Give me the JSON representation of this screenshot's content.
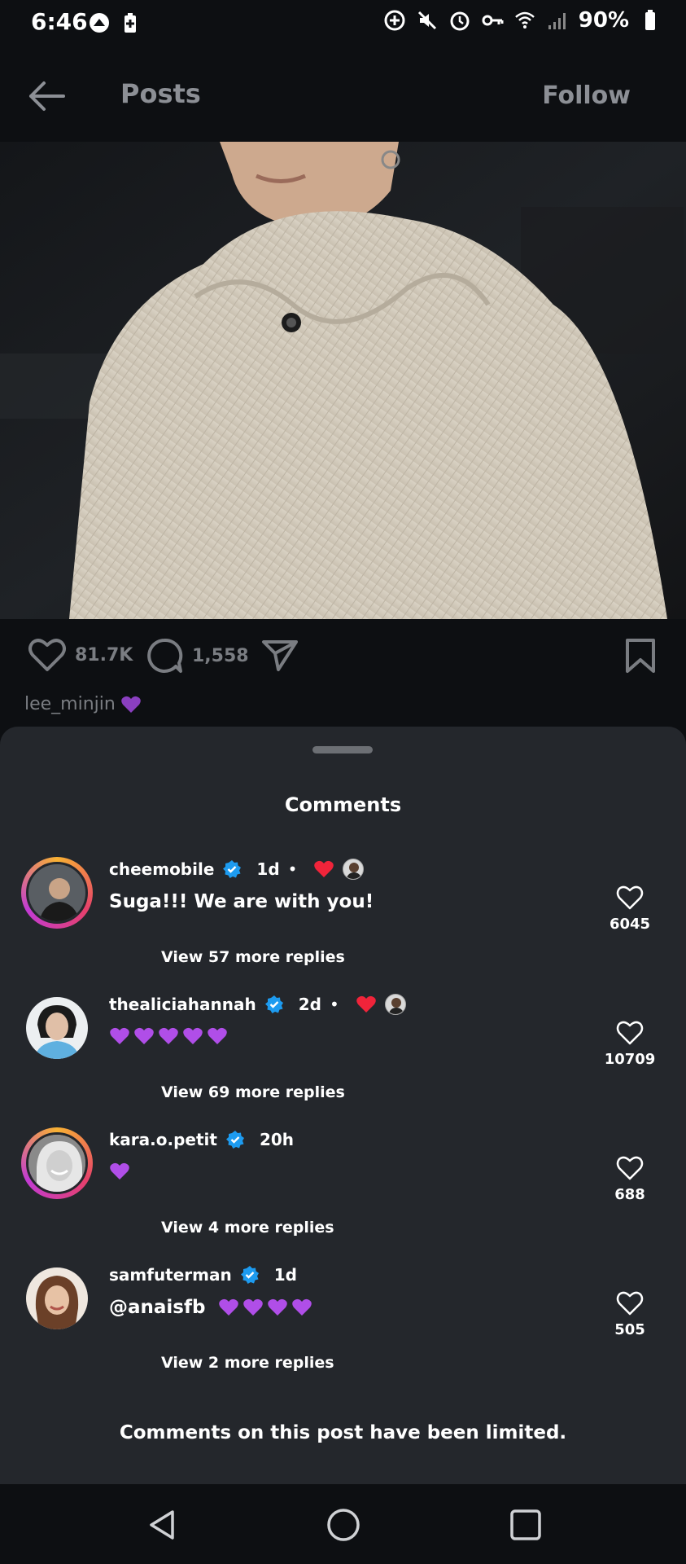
{
  "status_bar": {
    "time": "6:46",
    "battery": "90%"
  },
  "header": {
    "title": "Posts",
    "follow_label": "Follow"
  },
  "post": {
    "likes": "81.7K",
    "comments_count": "1,558",
    "caption_user": "lee_minjin"
  },
  "sheet": {
    "title": "Comments",
    "limited_notice": "Comments on this post have been limited."
  },
  "comments": [
    {
      "username": "cheemobile",
      "time": "1d",
      "dot": "•",
      "text": "Suga!!! We are with you!",
      "hearts": 0,
      "replies": "View 57 more replies",
      "likes": "6045"
    },
    {
      "username": "thealiciahannah",
      "time": "2d",
      "dot": "•",
      "text": "",
      "hearts": 5,
      "replies": "View 69 more replies",
      "likes": "10709"
    },
    {
      "username": "kara.o.petit",
      "time": "20h",
      "text": "",
      "hearts": 1,
      "replies": "View 4 more replies",
      "likes": "688"
    },
    {
      "username": "samfuterman",
      "time": "1d",
      "text": "@anaisfb",
      "hearts": 4,
      "replies": "View 2 more replies",
      "likes": "505"
    }
  ],
  "colors": {
    "background": "#0d0f12",
    "sheet": "#24272c",
    "muted_text": "#8c8f95",
    "verified": "#1d9bf0",
    "heart_red": "#f0243a",
    "heart_purple": "#b04ee8"
  },
  "icons": {
    "back": "arrow-left-icon",
    "like": "heart-outline-icon",
    "comment": "speech-bubble-icon",
    "share": "paper-plane-icon",
    "save": "bookmark-icon",
    "verified": "verified-badge-icon",
    "nav_back": "triangle-back-icon",
    "nav_home": "circle-home-icon",
    "nav_recents": "square-recents-icon"
  }
}
